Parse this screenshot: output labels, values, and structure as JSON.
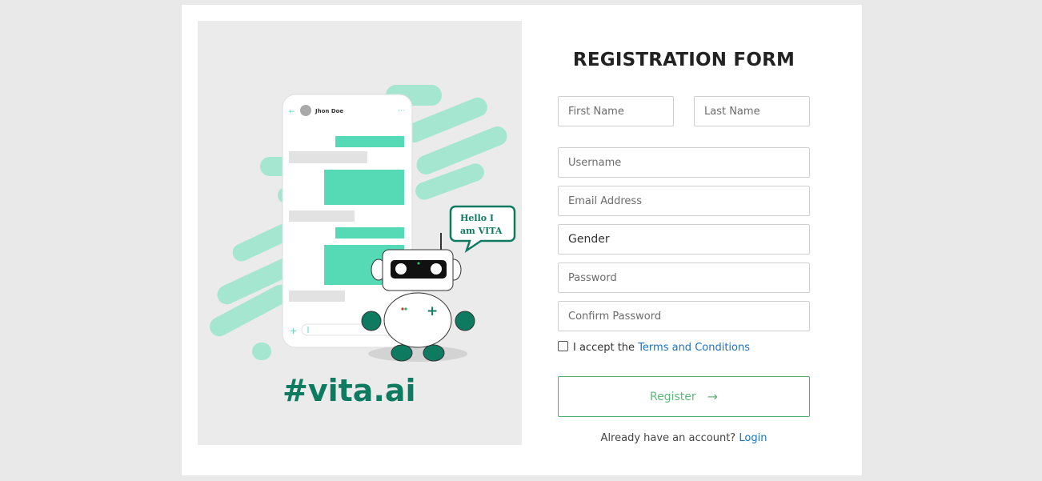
{
  "illustration": {
    "chat_contact_name": "Jhon Doe",
    "speech_bubble_line1": "Hello I",
    "speech_bubble_line2": "am VITA",
    "brand_tagline": "#vita.ai"
  },
  "form": {
    "title": "REGISTRATION FORM",
    "first_name_placeholder": "First Name",
    "last_name_placeholder": "Last Name",
    "username_placeholder": "Username",
    "email_placeholder": "Email Address",
    "gender_value": "Gender",
    "password_placeholder": "Password",
    "confirm_password_placeholder": "Confirm Password",
    "terms_prefix": "I accept the",
    "terms_link": "Terms and Conditions",
    "register_label": "Register",
    "login_prefix": "Already have an account?",
    "login_link": "Login"
  },
  "colors": {
    "accent_green": "#56d9b5",
    "brand_teal": "#0e7b61",
    "link_blue": "#1a73c4",
    "button_border": "#4fae6b"
  }
}
